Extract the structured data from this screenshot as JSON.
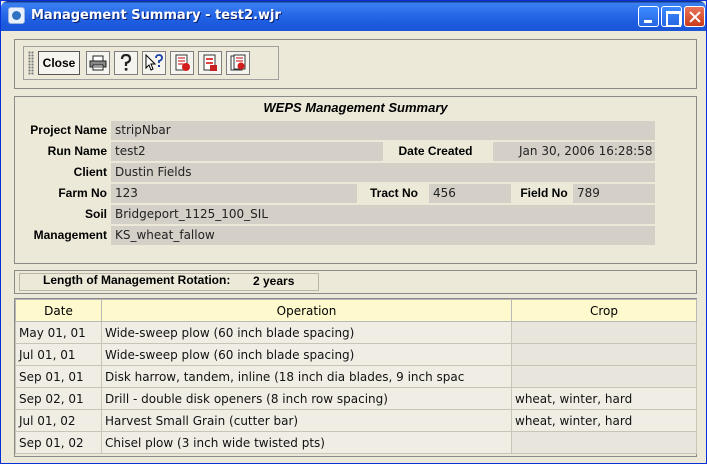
{
  "window": {
    "title": "Management Summary - test2.wjr"
  },
  "toolbar": {
    "close_label": "Close",
    "icons": [
      "printer-icon",
      "help-icon",
      "context-help-icon",
      "report-red-icon",
      "report-doc-icon",
      "report-close-icon"
    ]
  },
  "summary": {
    "title": "WEPS Management Summary",
    "project_name_label": "Project Name",
    "project_name": "stripNbar",
    "run_name_label": "Run Name",
    "run_name": "test2",
    "date_created_label": "Date Created",
    "date_created": "Jan 30, 2006 16:28:58",
    "client_label": "Client",
    "client": "Dustin Fields",
    "farm_no_label": "Farm No",
    "farm_no": "123",
    "tract_no_label": "Tract No",
    "tract_no": "456",
    "field_no_label": "Field No",
    "field_no": "789",
    "soil_label": "Soil",
    "soil": "Bridgeport_1125_100_SIL",
    "management_label": "Management",
    "management": "KS_wheat_fallow"
  },
  "rotation": {
    "label": "Length of Management Rotation:",
    "value": "2 years"
  },
  "operations": {
    "headers": [
      "Date",
      "Operation",
      "Crop"
    ],
    "rows": [
      {
        "date": "May 01, 01",
        "operation": "Wide-sweep plow (60 inch blade spacing)",
        "crop": ""
      },
      {
        "date": "Jul 01, 01",
        "operation": "Wide-sweep plow (60 inch blade spacing)",
        "crop": ""
      },
      {
        "date": "Sep 01, 01",
        "operation": "Disk harrow, tandem, inline (18 inch dia blades, 9 inch spac",
        "crop": ""
      },
      {
        "date": "Sep 02, 01",
        "operation": "Drill - double disk openers (8 inch row spacing)",
        "crop": "wheat, winter, hard"
      },
      {
        "date": "Jul 01, 02",
        "operation": "Harvest Small Grain (cutter bar)",
        "crop": "wheat, winter, hard"
      },
      {
        "date": "Sep 01, 02",
        "operation": "Chisel plow (3 inch wide twisted pts)",
        "crop": ""
      }
    ]
  }
}
